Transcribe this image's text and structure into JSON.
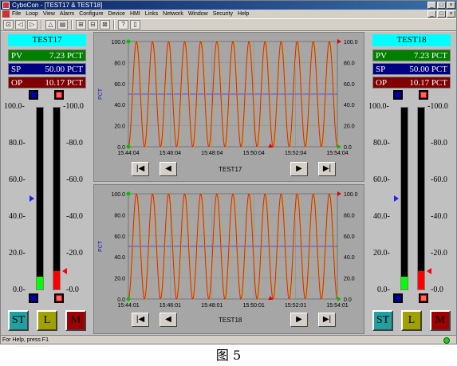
{
  "window": {
    "title": "CyboCon - [TEST17 & TEST18]",
    "controls": [
      "_",
      "□",
      "×"
    ],
    "mdi_controls": [
      "_",
      "□",
      "×"
    ]
  },
  "menu": [
    "File",
    "Loop",
    "View",
    "Alarm",
    "Configure",
    "Device",
    "HMI",
    "Links",
    "Network",
    "Window",
    "Security",
    "Help"
  ],
  "toolbar": [
    "⊡",
    "◁",
    "▷",
    "△",
    "▤",
    "⊞",
    "⊟",
    "⊠",
    "?",
    "▯"
  ],
  "left": {
    "tag": "TEST17",
    "pv_label": "PV",
    "pv_value": "7.23 PCT",
    "sp_label": "SP",
    "sp_value": "50.00 PCT",
    "op_label": "OP",
    "op_value": "10.17 PCT",
    "ticks_left": [
      "100.0-",
      "80.0-",
      "60.0-",
      "40.0-",
      "20.0-",
      "0.0-"
    ],
    "ticks_right": [
      "-100.0",
      "-80.0",
      "-60.0",
      "-40.0",
      "-20.0",
      "-0.0"
    ],
    "pv_level": 0.0723,
    "sp_level": 0.5,
    "op_level": 0.1017,
    "buttons": [
      "ST",
      "L",
      "M"
    ]
  },
  "right": {
    "tag": "TEST18",
    "pv_label": "PV",
    "pv_value": "7.23 PCT",
    "sp_label": "SP",
    "sp_value": "50.00 PCT",
    "op_label": "OP",
    "op_value": "10.17 PCT",
    "ticks_left": [
      "100.0-",
      "80.0-",
      "60.0-",
      "40.0-",
      "20.0-",
      "0.0-"
    ],
    "ticks_right": [
      "-100.0",
      "-80.0",
      "-60.0",
      "-40.0",
      "-20.0",
      "-0.0"
    ],
    "pv_level": 0.0723,
    "sp_level": 0.5,
    "op_level": 0.1017,
    "buttons": [
      "ST",
      "L",
      "M"
    ]
  },
  "chart_data": [
    {
      "type": "line",
      "title": "TEST17",
      "ylabel": "PCT",
      "ylim": [
        0,
        100
      ],
      "y_ticks": [
        "100.0",
        "80.0",
        "60.0",
        "40.0",
        "20.0",
        "0.0"
      ],
      "x_ticks": [
        "15:44:04",
        "15:46:04",
        "15:48:04",
        "15:50:04",
        "15:52:04",
        "15:54:04"
      ],
      "series": [
        {
          "values": [
            0,
            100
          ],
          "cycles": 13
        },
        {
          "values": [
            0,
            100
          ],
          "cycles": 13
        }
      ],
      "setpoint": 50
    },
    {
      "type": "line",
      "title": "TEST18",
      "ylabel": "PCT",
      "ylim": [
        0,
        100
      ],
      "y_ticks": [
        "100.0",
        "80.0",
        "60.0",
        "40.0",
        "20.0",
        "0.0"
      ],
      "x_ticks": [
        "15:44:01",
        "15:46:01",
        "15:48:01",
        "15:50:01",
        "15:52:01",
        "15:54:01"
      ],
      "series": [
        {
          "values": [
            0,
            100
          ],
          "cycles": 13
        },
        {
          "values": [
            0,
            100
          ],
          "cycles": 13
        }
      ],
      "setpoint": 50
    }
  ],
  "nav": {
    "first": "|◀",
    "prev": "◀",
    "next": "▶",
    "last": "▶|"
  },
  "status": {
    "text": "For Help, press F1"
  },
  "caption": "图 5",
  "colors": {
    "pv": "#008000",
    "sp": "#000080",
    "op": "#800000",
    "tag": "#00ffff",
    "trace_red": "#e02020",
    "trace_yellow": "#c8b000",
    "setpoint": "#3030ff"
  }
}
